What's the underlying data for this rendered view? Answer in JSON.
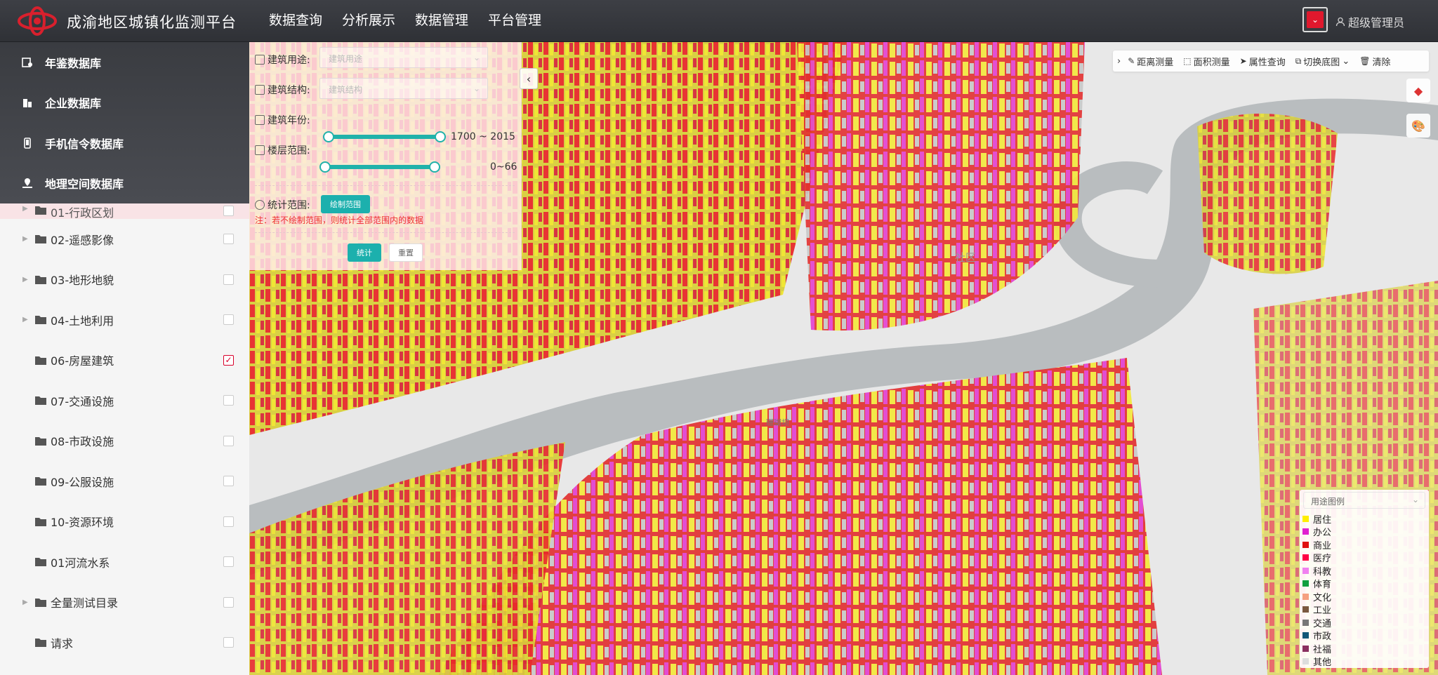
{
  "header": {
    "app_title": "成渝地区城镇化监测平台",
    "nav": [
      "数据查询",
      "分析展示",
      "数据管理",
      "平台管理"
    ],
    "user": "超级管理员",
    "accent": "#e0182d"
  },
  "sidebar": {
    "databases": [
      "年鉴数据库",
      "企业数据库",
      "手机信令数据库",
      "地理空间数据库"
    ],
    "tree": [
      {
        "label": "01-行政区划",
        "expandable": true,
        "checked": false
      },
      {
        "label": "02-遥感影像",
        "expandable": true,
        "checked": false
      },
      {
        "label": "03-地形地貌",
        "expandable": true,
        "checked": false
      },
      {
        "label": "04-土地利用",
        "expandable": true,
        "checked": false
      },
      {
        "label": "06-房屋建筑",
        "expandable": false,
        "checked": true
      },
      {
        "label": "07-交通设施",
        "expandable": false,
        "checked": false
      },
      {
        "label": "08-市政设施",
        "expandable": false,
        "checked": false
      },
      {
        "label": "09-公服设施",
        "expandable": false,
        "checked": false
      },
      {
        "label": "10-资源环境",
        "expandable": false,
        "checked": false
      },
      {
        "label": "01河流水系",
        "expandable": false,
        "checked": false
      },
      {
        "label": "全量测试目录",
        "expandable": true,
        "checked": false
      },
      {
        "label": "请求",
        "expandable": false,
        "checked": false
      }
    ]
  },
  "filter": {
    "usage_label": "建筑用途:",
    "usage_placeholder": "建筑用途",
    "structure_label": "建筑结构:",
    "structure_placeholder": "建筑结构",
    "year_label": "建筑年份:",
    "year_min": "1700",
    "year_sep": "~",
    "year_max": "2015",
    "floor_label": "楼层范围:",
    "floor_range": "0~66",
    "stat_label": "统计范围:",
    "draw_button": "绘制范围",
    "note": "注：若不绘制范围，则统计全部范围内的数据",
    "stat_button": "统计",
    "reset_button": "重置"
  },
  "toolbar": {
    "distance": "距离测量",
    "area": "面积测量",
    "attr": "属性查询",
    "basemap": "切换底图",
    "clear": "清除"
  },
  "map_labels": {
    "island": "珊瑚坝",
    "community": "社区"
  },
  "legend": {
    "title": "用途图例",
    "items": [
      {
        "label": "居住",
        "color": "#ffee00"
      },
      {
        "label": "办公",
        "color": "#e020d0"
      },
      {
        "label": "商业",
        "color": "#e01010"
      },
      {
        "label": "医疗",
        "color": "#ff0044"
      },
      {
        "label": "科教",
        "color": "#f080f0"
      },
      {
        "label": "体育",
        "color": "#10a040"
      },
      {
        "label": "文化",
        "color": "#f5a080"
      },
      {
        "label": "工业",
        "color": "#7a5a40"
      },
      {
        "label": "交通",
        "color": "#777777"
      },
      {
        "label": "市政",
        "color": "#105878"
      },
      {
        "label": "社福",
        "color": "#8a3060"
      },
      {
        "label": "其他",
        "color": "#dddddd"
      }
    ]
  }
}
